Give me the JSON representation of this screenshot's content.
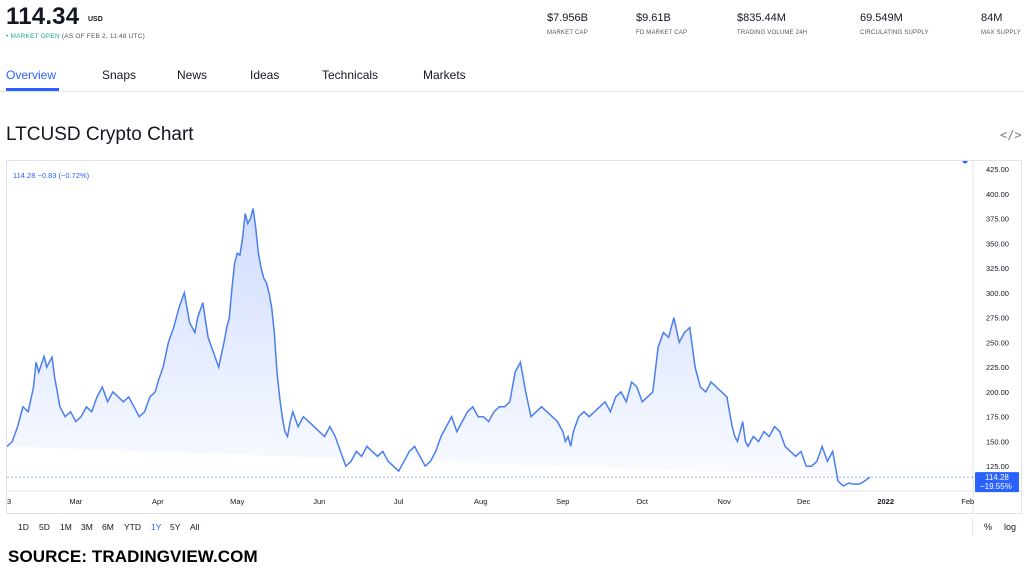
{
  "header": {
    "price": "114.34",
    "currency": "USD",
    "status_dot": "•",
    "status_label": "MARKET OPEN",
    "status_time": "(AS OF FEB 2, 11:48 UTC)",
    "stats": [
      {
        "value": "$7.956B",
        "label": "MARKET CAP"
      },
      {
        "value": "$9.61B",
        "label": "FD MARKET CAP"
      },
      {
        "value": "$835.44M",
        "label": "TRADING VOLUME 24H"
      },
      {
        "value": "69.549M",
        "label": "CIRCULATING SUPPLY"
      },
      {
        "value": "84M",
        "label": "MAX SUPPLY"
      }
    ]
  },
  "tabs": [
    "Overview",
    "Snaps",
    "News",
    "Ideas",
    "Technicals",
    "Markets"
  ],
  "chart_title": "LTCUSD Crypto Chart",
  "embed_icon": "</>",
  "ranges": [
    "1D",
    "5D",
    "1M",
    "3M",
    "6M",
    "YTD",
    "1Y",
    "5Y",
    "All"
  ],
  "active_range": "1Y",
  "scale_buttons": [
    "%",
    "log"
  ],
  "source_text": "SOURCE: TRADINGVIEW.COM",
  "colors": {
    "accent": "#2962ff",
    "line": "#4a7ef0",
    "open": "#22ab94"
  },
  "chart_data": {
    "type": "area",
    "legend_text": "114.28 −0.83 (−0.72%)",
    "last_value_label": "114.28",
    "last_change_label": "−19.55%",
    "ylim": [
      100,
      425
    ],
    "yticks": [
      "425.00",
      "400.00",
      "375.00",
      "350.00",
      "325.00",
      "300.00",
      "275.00",
      "250.00",
      "225.00",
      "200.00",
      "175.00",
      "150.00",
      "125.00"
    ],
    "ytick_values": [
      425,
      400,
      375,
      350,
      325,
      300,
      275,
      250,
      225,
      200,
      175,
      150,
      125
    ],
    "xlim": [
      0,
      365
    ],
    "xticks": [
      {
        "label": "3",
        "x": 0
      },
      {
        "label": "Mar",
        "x": 26
      },
      {
        "label": "Apr",
        "x": 57
      },
      {
        "label": "May",
        "x": 87
      },
      {
        "label": "Jun",
        "x": 118
      },
      {
        "label": "Jul",
        "x": 148
      },
      {
        "label": "Aug",
        "x": 179
      },
      {
        "label": "Sep",
        "x": 210
      },
      {
        "label": "Oct",
        "x": 240
      },
      {
        "label": "Nov",
        "x": 271
      },
      {
        "label": "Dec",
        "x": 301
      },
      {
        "label": "2022",
        "x": 332
      },
      {
        "label": "Feb",
        "x": 363
      }
    ],
    "x": [
      0,
      2,
      4,
      6,
      8,
      10,
      11,
      12,
      13,
      14,
      15,
      16,
      17,
      18,
      19,
      20,
      22,
      24,
      26,
      28,
      30,
      32,
      34,
      36,
      38,
      40,
      42,
      44,
      46,
      48,
      50,
      52,
      54,
      56,
      57,
      59,
      61,
      63,
      65,
      67,
      69,
      71,
      72,
      74,
      76,
      78,
      80,
      82,
      83,
      84,
      85,
      86,
      87,
      88,
      89,
      90,
      91,
      92,
      93,
      94,
      95,
      96,
      97,
      98,
      99,
      100,
      101,
      102,
      103,
      104,
      105,
      106,
      107,
      108,
      110,
      112,
      114,
      116,
      118,
      120,
      122,
      124,
      126,
      128,
      130,
      132,
      134,
      136,
      138,
      140,
      142,
      144,
      146,
      148,
      150,
      152,
      154,
      156,
      158,
      160,
      162,
      164,
      166,
      168,
      170,
      172,
      174,
      176,
      178,
      180,
      182,
      184,
      186,
      188,
      190,
      192,
      194,
      196,
      198,
      200,
      202,
      204,
      206,
      208,
      209,
      210,
      211,
      212,
      213,
      214,
      216,
      218,
      220,
      222,
      224,
      226,
      228,
      230,
      232,
      234,
      236,
      238,
      240,
      242,
      244,
      246,
      248,
      250,
      252,
      254,
      256,
      258,
      260,
      262,
      264,
      266,
      268,
      270,
      272,
      273,
      274,
      275,
      276,
      277,
      278,
      279,
      280,
      282,
      284,
      286,
      288,
      290,
      292,
      294,
      296,
      298,
      300,
      302,
      304,
      306,
      308,
      310,
      312,
      314,
      316,
      318,
      320,
      322,
      324,
      326,
      328,
      330,
      332,
      334,
      336,
      338,
      340,
      342,
      344,
      346,
      348,
      350,
      352,
      354,
      356,
      358,
      360,
      362
    ],
    "y": [
      145,
      150,
      165,
      185,
      180,
      205,
      230,
      220,
      228,
      236,
      225,
      230,
      235,
      215,
      200,
      185,
      175,
      180,
      170,
      175,
      185,
      180,
      195,
      205,
      190,
      200,
      195,
      190,
      195,
      185,
      175,
      180,
      195,
      200,
      210,
      225,
      250,
      265,
      285,
      300,
      270,
      260,
      275,
      290,
      255,
      240,
      225,
      250,
      265,
      275,
      305,
      330,
      340,
      338,
      355,
      380,
      370,
      375,
      385,
      365,
      340,
      325,
      315,
      310,
      300,
      285,
      260,
      220,
      195,
      175,
      160,
      155,
      170,
      180,
      165,
      175,
      170,
      165,
      160,
      155,
      165,
      155,
      140,
      125,
      130,
      140,
      135,
      145,
      140,
      135,
      140,
      130,
      125,
      120,
      130,
      140,
      145,
      135,
      125,
      130,
      140,
      155,
      165,
      175,
      160,
      170,
      180,
      185,
      175,
      175,
      170,
      180,
      185,
      185,
      190,
      220,
      230,
      200,
      175,
      180,
      185,
      180,
      175,
      170,
      165,
      160,
      150,
      155,
      145,
      160,
      175,
      180,
      175,
      180,
      185,
      190,
      180,
      195,
      200,
      190,
      210,
      205,
      190,
      195,
      200,
      245,
      260,
      255,
      275,
      250,
      260,
      265,
      225,
      205,
      200,
      210,
      205,
      200,
      195,
      180,
      165,
      155,
      150,
      160,
      170,
      150,
      145,
      155,
      150,
      160,
      155,
      165,
      160,
      145,
      140,
      135,
      140,
      125,
      125,
      130,
      145,
      130,
      140,
      110,
      105,
      108,
      107,
      107,
      110,
      114
    ]
  }
}
